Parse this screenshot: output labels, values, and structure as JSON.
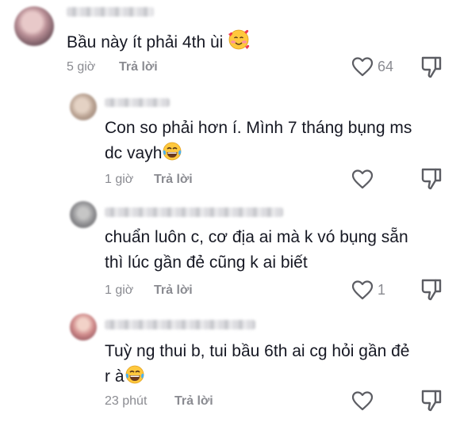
{
  "comments": [
    {
      "text": "Bầu này ít phải 4th ùi",
      "emoji": "smiling-face-with-hearts",
      "time": "5 giờ",
      "reply": "Trả lời",
      "likes": "64"
    },
    {
      "line1": "Con so phải hơn í. Mình 7 tháng bụng ms",
      "line2": "dc vayh",
      "emoji": "face-with-tears-of-joy",
      "time": "1 giờ",
      "reply": "Trả lời",
      "likes": ""
    },
    {
      "line1": "chuẩn luôn c, cơ địa ai mà k vó bụng sẵn",
      "line2": "thì lúc gần đẻ cũng k ai biết",
      "time": "1 giờ",
      "reply": "Trả lời",
      "likes": "1"
    },
    {
      "line1": "Tuỳ ng thui b, tui bầu 6th ai cg hỏi gần đẻ",
      "line2": "r à",
      "emoji": "face-with-tears-of-joy",
      "time": "23 phút",
      "reply": "Trả lời",
      "likes": ""
    }
  ],
  "icons": {
    "like": "heart-outline-icon",
    "dislike": "thumbs-down-outline-icon"
  }
}
